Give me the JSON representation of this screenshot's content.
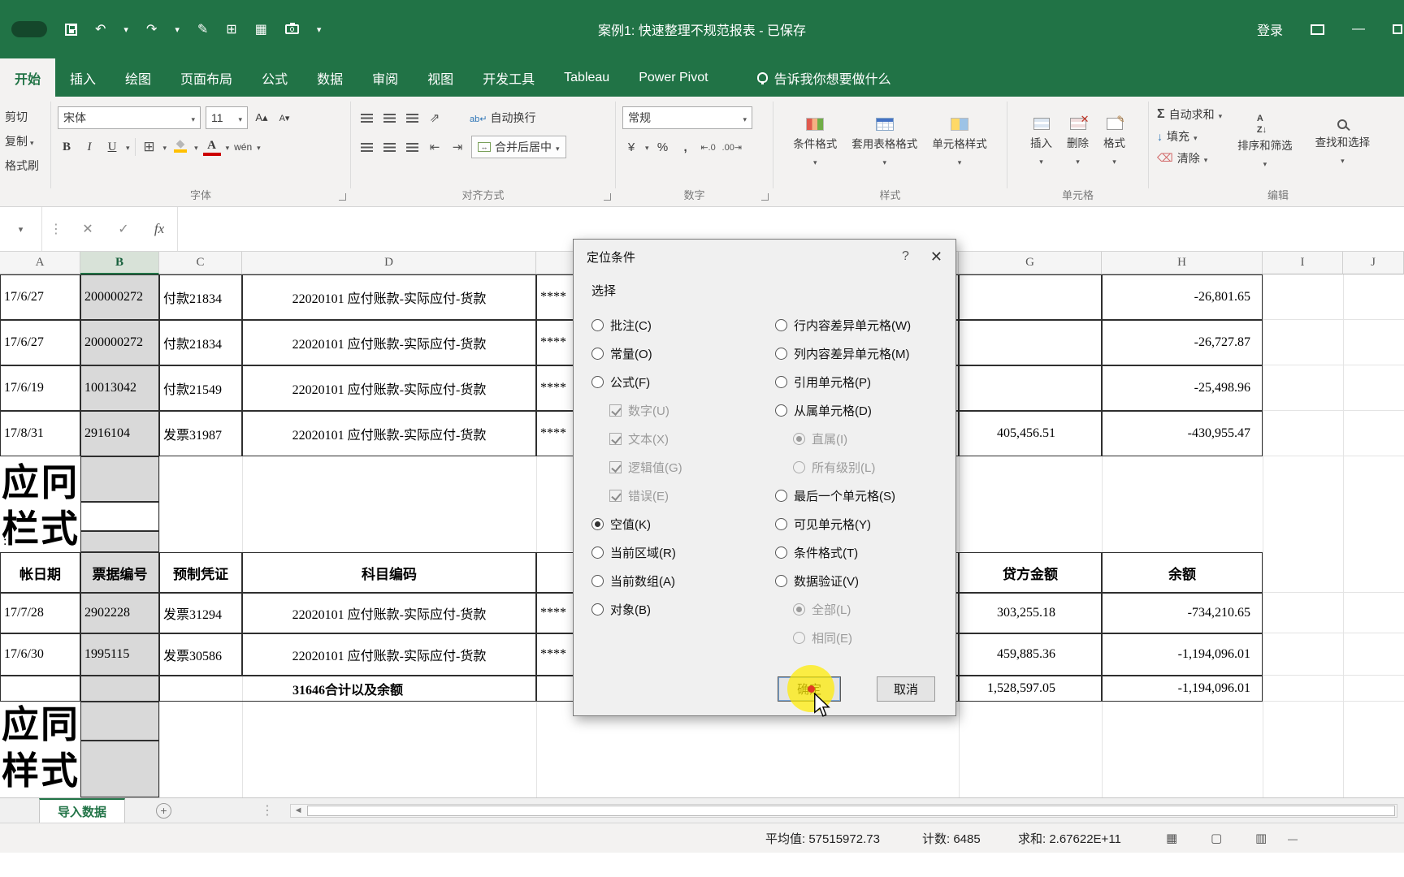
{
  "colors": {
    "excel_green": "#217346",
    "selected_column_fill": "#d9d9d9",
    "highlight_yellow": "#ffec00",
    "table_border": "#2f2f2f"
  },
  "title_bar": {
    "title": "案例1: 快速整理不规范报表 - 已保存",
    "sign_in": "登录"
  },
  "ribbon_tabs": {
    "tabs": [
      "开始",
      "插入",
      "绘图",
      "页面布局",
      "公式",
      "数据",
      "审阅",
      "视图",
      "开发工具",
      "Tableau",
      "Power Pivot"
    ],
    "tell_me": "告诉我你想要做什么"
  },
  "ribbon": {
    "clipboard": {
      "cut": "剪切",
      "copy": "复制",
      "painter": "格式刷"
    },
    "font": {
      "name": "宋体",
      "size": "11",
      "bold": "B",
      "italic": "I",
      "underline": "U",
      "phonetic": "wén",
      "group": "字体"
    },
    "alignment": {
      "wrap": "自动换行",
      "merge": "合并后居中",
      "group": "对齐方式"
    },
    "number": {
      "format": "常规",
      "group": "数字"
    },
    "styles": {
      "conditional": "条件格式",
      "format_table": "套用表格格式",
      "cell_styles": "单元格样式",
      "group": "样式"
    },
    "cells": {
      "insert": "插入",
      "delete": "删除",
      "format": "格式",
      "group": "单元格"
    },
    "editing": {
      "autosum": "自动求和",
      "fill": "填充",
      "clear": "清除",
      "sort": "排序和筛选",
      "find": "查找和选择",
      "group": "编辑"
    }
  },
  "formula_bar": {
    "fx": "fx"
  },
  "grid": {
    "columns": [
      "A",
      "B",
      "C",
      "D",
      "G",
      "H",
      "I",
      "J"
    ],
    "selected_column": "B",
    "rows": [
      {
        "date": "17/6/27",
        "doc": "200000272",
        "voucher": "付款21834",
        "account": "22020101 应付账款-实际应付-货款",
        "stars": "****",
        "credit": "",
        "balance": "-26,801.65"
      },
      {
        "date": "17/6/27",
        "doc": "200000272",
        "voucher": "付款21834",
        "account": "22020101 应付账款-实际应付-货款",
        "stars": "****",
        "credit": "",
        "balance": "-26,727.87"
      },
      {
        "date": "17/6/19",
        "doc": "10013042",
        "voucher": "付款21549",
        "account": "22020101 应付账款-实际应付-货款",
        "stars": "****",
        "credit": "",
        "balance": "-25,498.96"
      },
      {
        "date": "17/8/31",
        "doc": "2916104",
        "voucher": "发票31987",
        "account": "22020101 应付账款-实际应付-货款",
        "stars": "****",
        "credit": "405,456.51",
        "balance": "-430,955.47"
      },
      {
        "date": "17/7/28",
        "doc": "2902228",
        "voucher": "发票31294",
        "account": "22020101 应付账款-实际应付-货款",
        "stars": "****",
        "credit": "303,255.18",
        "balance": "-734,210.65"
      },
      {
        "date": "17/6/30",
        "doc": "1995115",
        "voucher": "发票30586",
        "account": "22020101 应付账款-实际应付-货款",
        "stars": "****",
        "credit": "459,885.36",
        "balance": "-1,194,096.01"
      }
    ],
    "header_row": {
      "date": "帐日期",
      "doc": "票据编号",
      "voucher": "预制凭证",
      "account": "科目编码",
      "credit": "贷方金额",
      "balance": "余额"
    },
    "total_row": {
      "label": "31646合计以及余额",
      "credit": "1,528,597.05",
      "balance": "-1,194,096.01"
    },
    "colon": ":",
    "section_blocks": [
      {
        "line1": "应冋",
        "line2": "栏式"
      },
      {
        "line1": "应同",
        "line2": "样式"
      }
    ]
  },
  "dialog": {
    "title": "定位条件",
    "help": "?",
    "close": "✕",
    "section": "选择",
    "left_options": [
      {
        "label": "批注(C)",
        "type": "radio",
        "checked": false,
        "disabled": false,
        "indent": false
      },
      {
        "label": "常量(O)",
        "type": "radio",
        "checked": false,
        "disabled": false,
        "indent": false
      },
      {
        "label": "公式(F)",
        "type": "radio",
        "checked": false,
        "disabled": false,
        "indent": false
      },
      {
        "label": "数字(U)",
        "type": "checkbox",
        "checked": true,
        "disabled": true,
        "indent": true
      },
      {
        "label": "文本(X)",
        "type": "checkbox",
        "checked": true,
        "disabled": true,
        "indent": true
      },
      {
        "label": "逻辑值(G)",
        "type": "checkbox",
        "checked": true,
        "disabled": true,
        "indent": true
      },
      {
        "label": "错误(E)",
        "type": "checkbox",
        "checked": true,
        "disabled": true,
        "indent": true
      },
      {
        "label": "空值(K)",
        "type": "radio",
        "checked": true,
        "disabled": false,
        "indent": false
      },
      {
        "label": "当前区域(R)",
        "type": "radio",
        "checked": false,
        "disabled": false,
        "indent": false
      },
      {
        "label": "当前数组(A)",
        "type": "radio",
        "checked": false,
        "disabled": false,
        "indent": false
      },
      {
        "label": "对象(B)",
        "type": "radio",
        "checked": false,
        "disabled": false,
        "indent": false
      }
    ],
    "right_options": [
      {
        "label": "行内容差异单元格(W)",
        "type": "radio",
        "checked": false,
        "disabled": false,
        "indent": false
      },
      {
        "label": "列内容差异单元格(M)",
        "type": "radio",
        "checked": false,
        "disabled": false,
        "indent": false
      },
      {
        "label": "引用单元格(P)",
        "type": "radio",
        "checked": false,
        "disabled": false,
        "indent": false
      },
      {
        "label": "从属单元格(D)",
        "type": "radio",
        "checked": false,
        "disabled": false,
        "indent": false
      },
      {
        "label": "直属(I)",
        "type": "radio",
        "checked": true,
        "disabled": true,
        "indent": true
      },
      {
        "label": "所有级别(L)",
        "type": "radio",
        "checked": false,
        "disabled": true,
        "indent": true
      },
      {
        "label": "最后一个单元格(S)",
        "type": "radio",
        "checked": false,
        "disabled": false,
        "indent": false
      },
      {
        "label": "可见单元格(Y)",
        "type": "radio",
        "checked": false,
        "disabled": false,
        "indent": false
      },
      {
        "label": "条件格式(T)",
        "type": "radio",
        "checked": false,
        "disabled": false,
        "indent": false
      },
      {
        "label": "数据验证(V)",
        "type": "radio",
        "checked": false,
        "disabled": false,
        "indent": false
      },
      {
        "label": "全部(L)",
        "type": "radio",
        "checked": true,
        "disabled": true,
        "indent": true
      },
      {
        "label": "相同(E)",
        "type": "radio",
        "checked": false,
        "disabled": true,
        "indent": true
      }
    ],
    "ok": "确定",
    "cancel": "取消"
  },
  "sheet_bar": {
    "tab": "导入数据"
  },
  "status_bar": {
    "average": "平均值: 57515972.73",
    "count": "计数: 6485",
    "sum": "求和: 2.67622E+11"
  }
}
